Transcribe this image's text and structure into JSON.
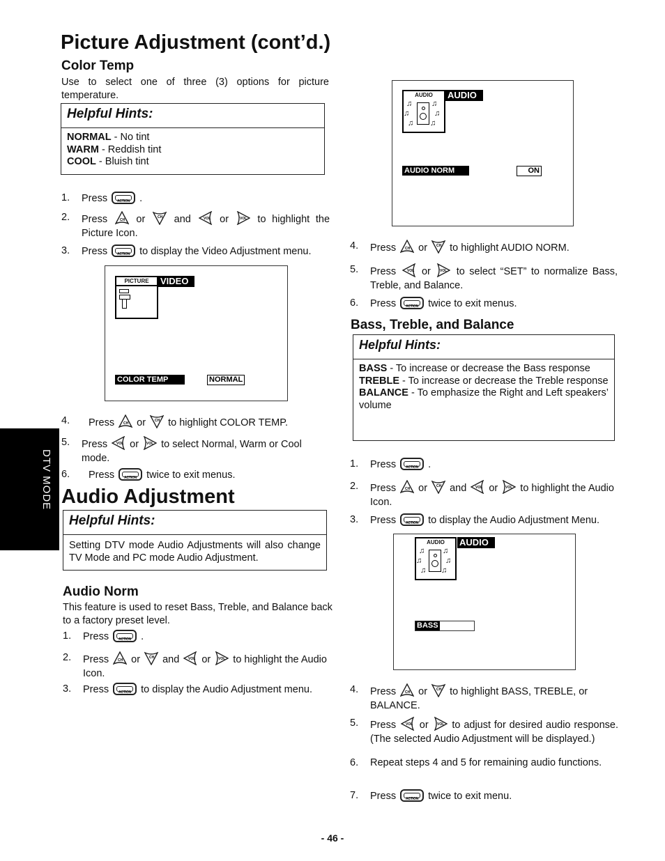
{
  "page": {
    "title": "Picture Adjustment (cont’d.)",
    "page_number": "- 46 -",
    "side_tab": "DTV MODE"
  },
  "color_temp": {
    "heading": "Color Temp",
    "intro": "Use to select one of three (3) options for picture temperature.",
    "hints": {
      "title": "Helpful Hints:",
      "items": [
        {
          "term": "NORMAL",
          "desc": " - No tint"
        },
        {
          "term": "WARM",
          "desc": " - Reddish tint"
        },
        {
          "term": "COOL",
          "desc": " - Bluish tint"
        }
      ]
    },
    "steps_a": [
      {
        "num": "1.",
        "pre": "Press",
        "post": " ."
      },
      {
        "num": "2.",
        "pre": "Press",
        "or1": " or ",
        "and": " and ",
        "or2": " or ",
        "post": " to highlight the Picture Icon."
      },
      {
        "num": "3.",
        "pre": "Press",
        "post": " to display the Video Adjustment menu."
      }
    ],
    "menu": {
      "icon_label": "PICTURE",
      "title": "VIDEO",
      "item": "COLOR TEMP",
      "value": "NORMAL"
    },
    "steps_b": [
      {
        "num": "4.",
        "pre": "Press",
        "or1": " or ",
        "post": " to highlight COLOR TEMP."
      },
      {
        "num": "5.",
        "pre": "Press",
        "or1": " or ",
        "post": " to select Normal, Warm or Cool mode."
      },
      {
        "num": "6.",
        "pre": "Press",
        "post": " twice to exit menus."
      }
    ]
  },
  "audio_adjustment": {
    "heading": "Audio Adjustment",
    "hints": {
      "title": "Helpful Hints:",
      "text": "Setting DTV mode Audio Adjustments will also change TV Mode and PC mode Audio Adjustment."
    }
  },
  "audio_norm": {
    "heading": "Audio Norm",
    "intro": "This feature is used to reset Bass, Treble, and Balance back to a factory preset level.",
    "steps_a": [
      {
        "num": "1.",
        "pre": "Press",
        "post": " ."
      },
      {
        "num": "2.",
        "pre": "Press",
        "or1": " or ",
        "and": " and ",
        "or2": " or ",
        "post": " to highlight the Audio Icon."
      },
      {
        "num": "3.",
        "pre": "Press",
        "post": " to display the Audio Adjustment menu."
      }
    ],
    "menu": {
      "icon_label": "AUDIO",
      "title": "AUDIO",
      "item": "AUDIO NORM",
      "value": "ON"
    },
    "steps_b": [
      {
        "num": "4.",
        "pre": "Press",
        "or1": " or ",
        "post": " to highlight AUDIO NORM."
      },
      {
        "num": "5.",
        "pre": "Press",
        "or1": " or ",
        "post": " to select “SET” to normalize Bass, Treble, and Balance."
      },
      {
        "num": "6.",
        "pre": "Press",
        "post": " twice to exit menus."
      }
    ]
  },
  "bass_treble": {
    "heading": "Bass, Treble, and Balance",
    "hints": {
      "title": "Helpful Hints:",
      "items": [
        {
          "term": "BASS",
          "desc": " - To increase or decrease the Bass response"
        },
        {
          "term": "TREBLE",
          "desc": " - To increase or decrease the Treble response"
        },
        {
          "term": "BALANCE",
          "desc": " - To emphasize the Right and Left speakers’ volume"
        }
      ]
    },
    "steps_a": [
      {
        "num": "1.",
        "pre": "Press",
        "post": " ."
      },
      {
        "num": "2.",
        "pre": "Press",
        "or1": " or ",
        "and": " and ",
        "or2": " or ",
        "post": " to highlight the Audio Icon."
      },
      {
        "num": "3.",
        "pre": "Press",
        "post": " to display the Audio Adjustment Menu."
      }
    ],
    "menu": {
      "icon_label": "AUDIO",
      "title": "AUDIO",
      "item": "BASS"
    },
    "steps_b": [
      {
        "num": "4.",
        "pre": "Press",
        "or1": " or ",
        "post": " to highlight BASS, TREBLE, or BALANCE."
      },
      {
        "num": "5.",
        "pre": "Press",
        "or1": " or ",
        "post": " to adjust for desired audio response. (The selected Audio Adjustment will be displayed.)"
      },
      {
        "num": "6.",
        "text": "Repeat steps 4 and 5 for remaining audio functions."
      },
      {
        "num": "7.",
        "pre": "Press",
        "post": " twice to exit menu."
      }
    ]
  },
  "icons": {
    "action_button": "ACTION",
    "ch_up": "CH",
    "ch_down": "CH",
    "vol_left": "VOL",
    "vol_right": "VOL"
  }
}
